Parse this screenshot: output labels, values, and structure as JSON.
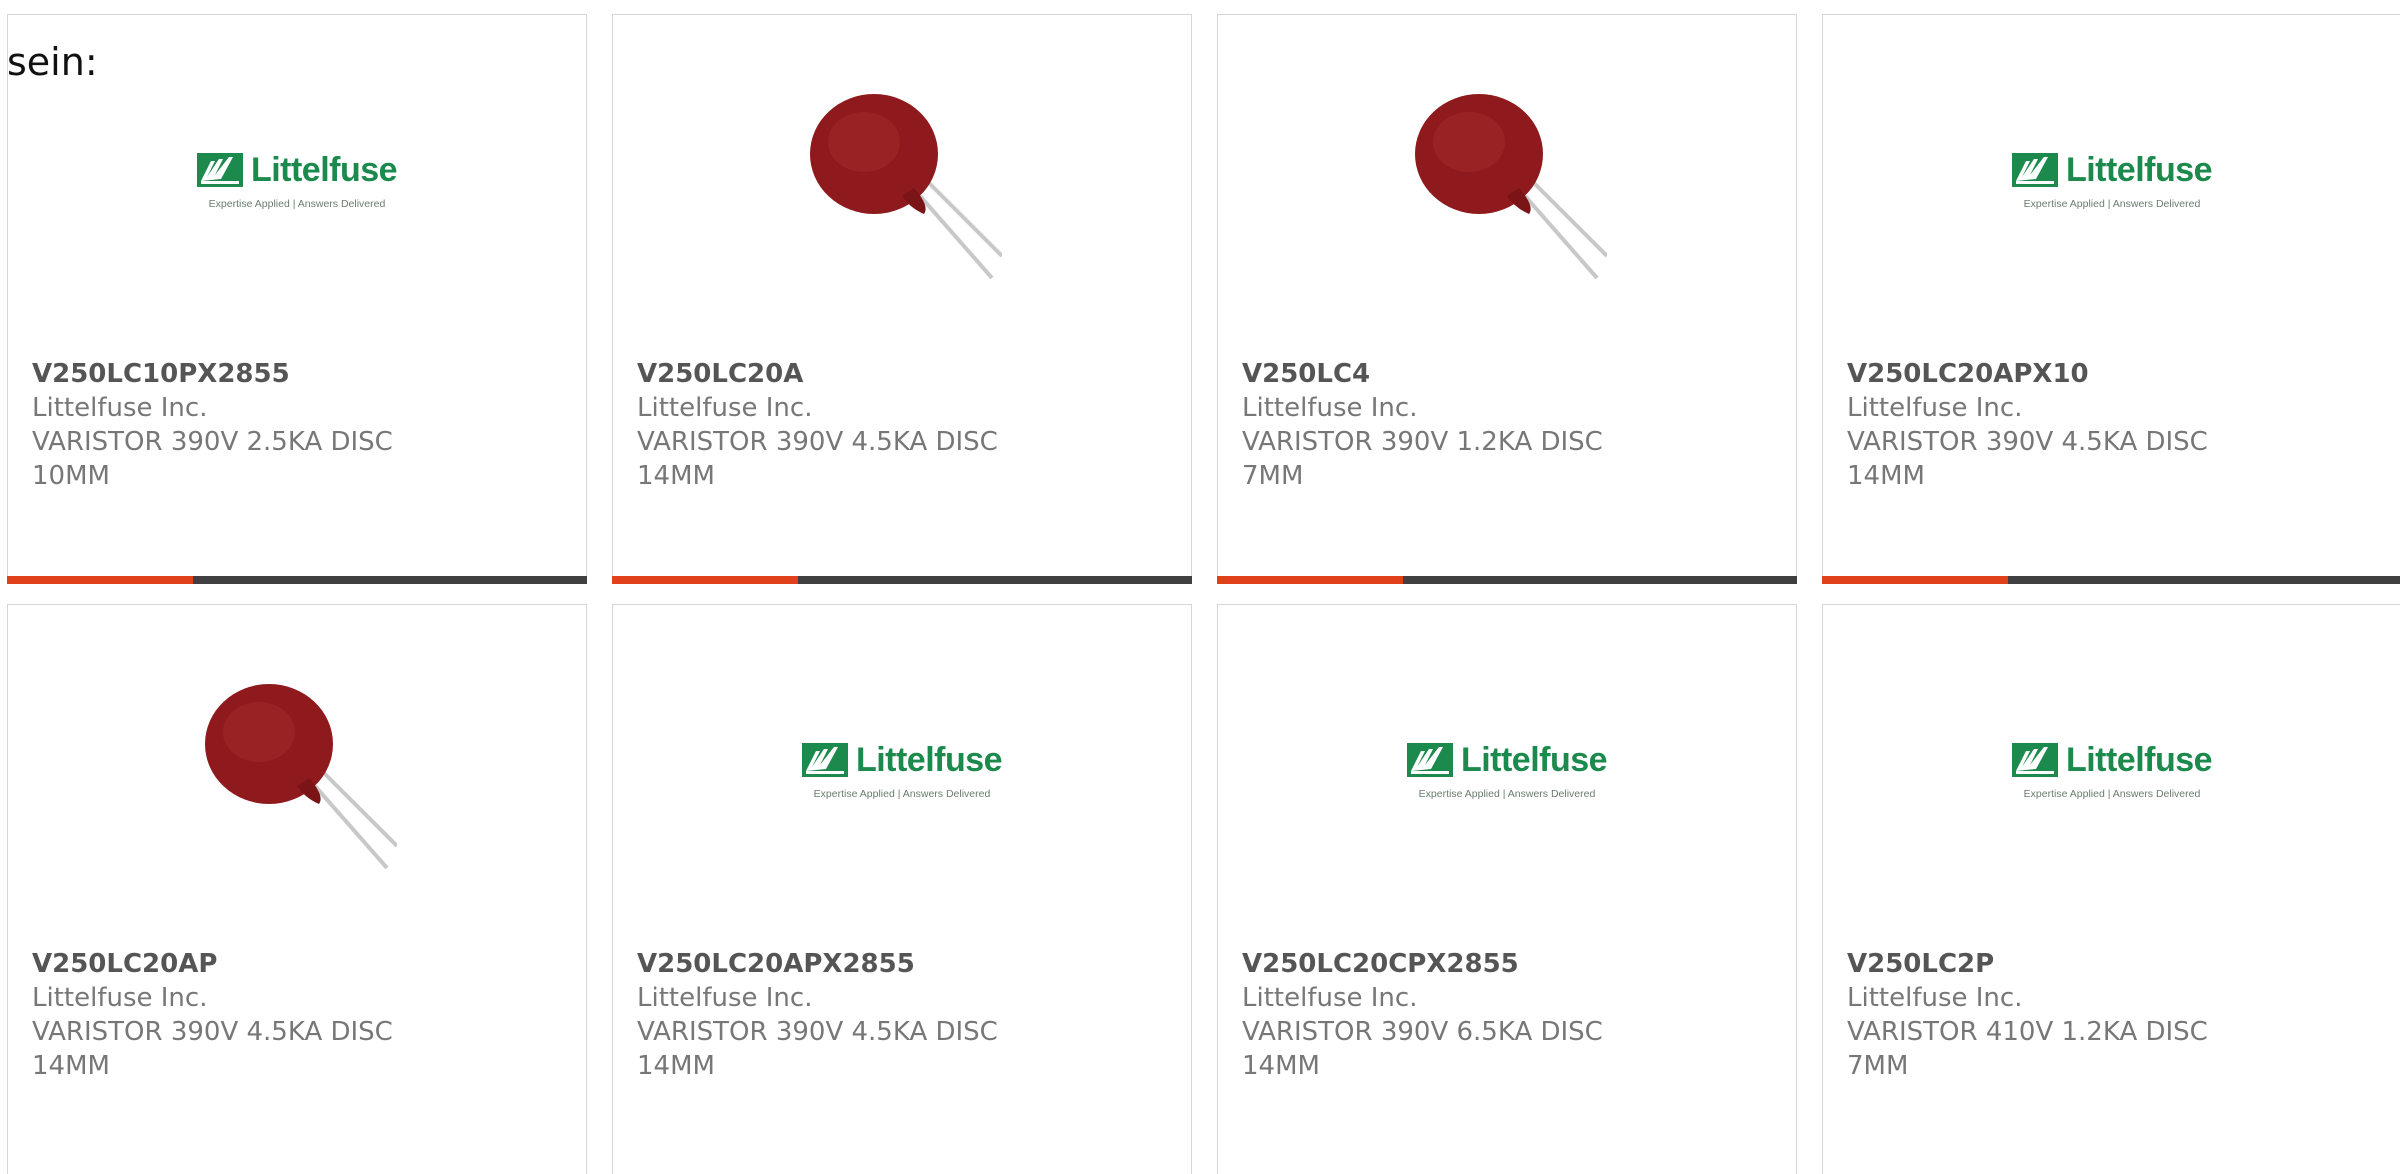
{
  "intro_text": "sein:",
  "logo": {
    "name": "Littelfuse",
    "tagline": "Expertise Applied | Answers Delivered",
    "brand_color": "#1b8a4c"
  },
  "colors": {
    "accent_bar": "#e0401a",
    "dark_bar": "#404040",
    "varistor_body": "#8e1a1d"
  },
  "cards": [
    {
      "part_number": "V250LC10PX2855",
      "manufacturer": "Littelfuse Inc.",
      "description": "VARISTOR 390V 2.5KA DISC 10MM",
      "image": "littelfuse-logo"
    },
    {
      "part_number": "V250LC20A",
      "manufacturer": "Littelfuse Inc.",
      "description": "VARISTOR 390V 4.5KA DISC 14MM",
      "image": "varistor-photo"
    },
    {
      "part_number": "V250LC4",
      "manufacturer": "Littelfuse Inc.",
      "description": "VARISTOR 390V 1.2KA DISC 7MM",
      "image": "varistor-photo"
    },
    {
      "part_number": "V250LC20APX10",
      "manufacturer": "Littelfuse Inc.",
      "description": "VARISTOR 390V 4.5KA DISC 14MM",
      "image": "littelfuse-logo"
    },
    {
      "part_number": "V250LC20AP",
      "manufacturer": "Littelfuse Inc.",
      "description": "VARISTOR 390V 4.5KA DISC 14MM",
      "image": "varistor-photo"
    },
    {
      "part_number": "V250LC20APX2855",
      "manufacturer": "Littelfuse Inc.",
      "description": "VARISTOR 390V 4.5KA DISC 14MM",
      "image": "littelfuse-logo"
    },
    {
      "part_number": "V250LC20CPX2855",
      "manufacturer": "Littelfuse Inc.",
      "description": "VARISTOR 390V 6.5KA DISC 14MM",
      "image": "littelfuse-logo"
    },
    {
      "part_number": "V250LC2P",
      "manufacturer": "Littelfuse Inc.",
      "description": "VARISTOR 410V 1.2KA DISC 7MM",
      "image": "littelfuse-logo"
    }
  ]
}
